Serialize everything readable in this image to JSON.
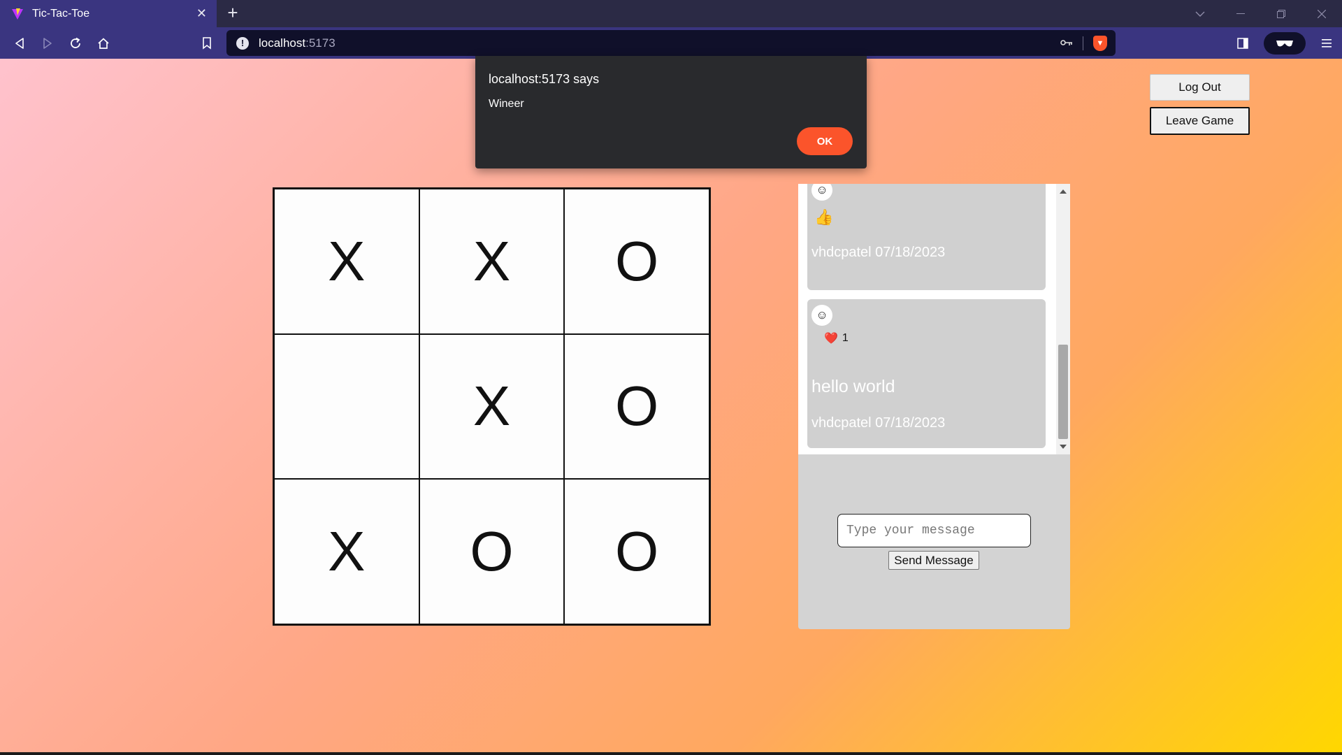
{
  "browser": {
    "tab_title": "Tic-Tac-Toe",
    "tab_close": "✕",
    "new_tab": "+",
    "url_host": "localhost",
    "url_port": ":5173",
    "info_icon": "!",
    "key_icon": "key-icon",
    "brave_accent": "#fb542b"
  },
  "header": {
    "logout_label": "Log Out",
    "leave_label": "Leave Game"
  },
  "board": {
    "cells": [
      "X",
      "X",
      "O",
      "",
      "X",
      "O",
      "X",
      "O",
      "O"
    ]
  },
  "chat": {
    "messages": [
      {
        "reaction": "👍",
        "meta": "vhdcpatel 07/18/2023"
      },
      {
        "reaction": "❤️",
        "reaction_count": "1",
        "text": "hello world",
        "meta": "vhdcpatel 07/18/2023"
      }
    ],
    "emoji_icon": "☺",
    "input_placeholder": "Type your message",
    "send_label": "Send Message"
  },
  "alert": {
    "title": "localhost:5173 says",
    "message": "Wineer",
    "ok_label": "OK"
  }
}
